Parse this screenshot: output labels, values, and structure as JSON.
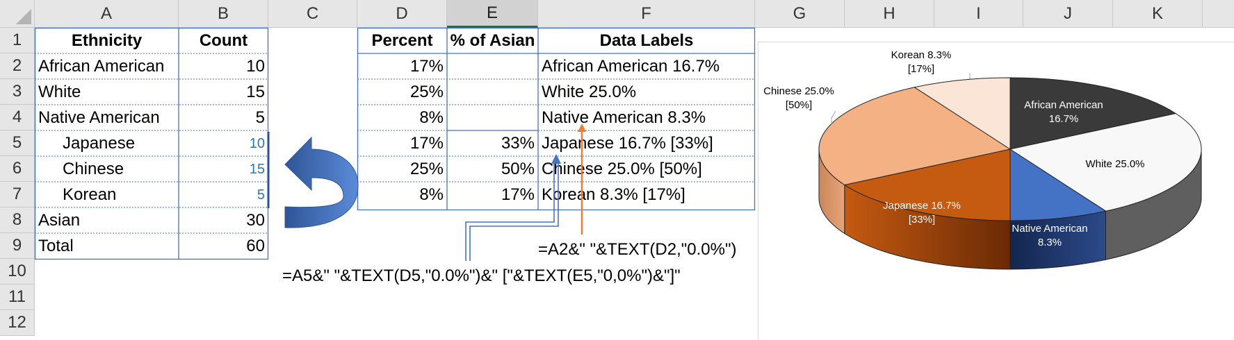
{
  "columns": [
    "A",
    "B",
    "C",
    "D",
    "E",
    "F",
    "G",
    "H",
    "I",
    "J",
    "K"
  ],
  "rows": [
    "1",
    "2",
    "3",
    "4",
    "5",
    "6",
    "7",
    "8",
    "9",
    "10",
    "11",
    "12"
  ],
  "headers": {
    "ethnicity": "Ethnicity",
    "count": "Count",
    "percent": "Percent",
    "pct_asian": "% of Asian",
    "data_labels": "Data Labels"
  },
  "table": [
    {
      "name": "African American",
      "count": "10",
      "percent": "17%",
      "pct_asian": "",
      "label": "African American 16.7%"
    },
    {
      "name": "White",
      "count": "15",
      "percent": "25%",
      "pct_asian": "",
      "label": "White 25.0%"
    },
    {
      "name": "Native American",
      "count": "5",
      "percent": "8%",
      "pct_asian": "",
      "label": "Native American 8.3%"
    },
    {
      "name": "Japanese",
      "count": "10",
      "percent": "17%",
      "pct_asian": "33%",
      "label": "Japanese 16.7% [33%]"
    },
    {
      "name": "Chinese",
      "count": "15",
      "percent": "25%",
      "pct_asian": "50%",
      "label": "Chinese 25.0% [50%]"
    },
    {
      "name": "Korean",
      "count": "5",
      "percent": "8%",
      "pct_asian": "17%",
      "label": "Korean 8.3% [17%]"
    },
    {
      "name": "Asian",
      "count": "30"
    },
    {
      "name": "Total",
      "count": "60"
    }
  ],
  "formulas": {
    "basic": "=A2&\" \"&TEXT(D2,\"0.0%\")",
    "asian": "=A5&\" \"&TEXT(D5,\"0.0%\")&\" [\"&TEXT(E5,\"0,0%\")&\"]\""
  },
  "pie_labels": {
    "african_american": [
      "African American",
      "16.7%"
    ],
    "white": [
      "White 25.0%"
    ],
    "native_american": [
      "Native American",
      "8.3%"
    ],
    "japanese": [
      "Japanese 16.7%",
      "[33%]"
    ],
    "chinese": [
      "Chinese 25.0%",
      "[50%]"
    ],
    "korean": [
      "Korean 8.3%",
      "[17%]"
    ]
  },
  "chart_data": {
    "type": "pie",
    "categories": [
      "African American",
      "White",
      "Native American",
      "Japanese",
      "Chinese",
      "Korean"
    ],
    "values": [
      10,
      15,
      5,
      10,
      15,
      5
    ],
    "colors": [
      "#3a3a3a",
      "#f8f8f8",
      "#4472c4",
      "#c55a11",
      "#f4b183",
      "#fbe5d6"
    ]
  },
  "colors": {
    "header_bg": "#e6e6e6",
    "border_blue": "#4472c4",
    "arrow_blue": "#4472c4",
    "arrow_orange": "#ed7d31",
    "excel_green": "#1e7145"
  }
}
